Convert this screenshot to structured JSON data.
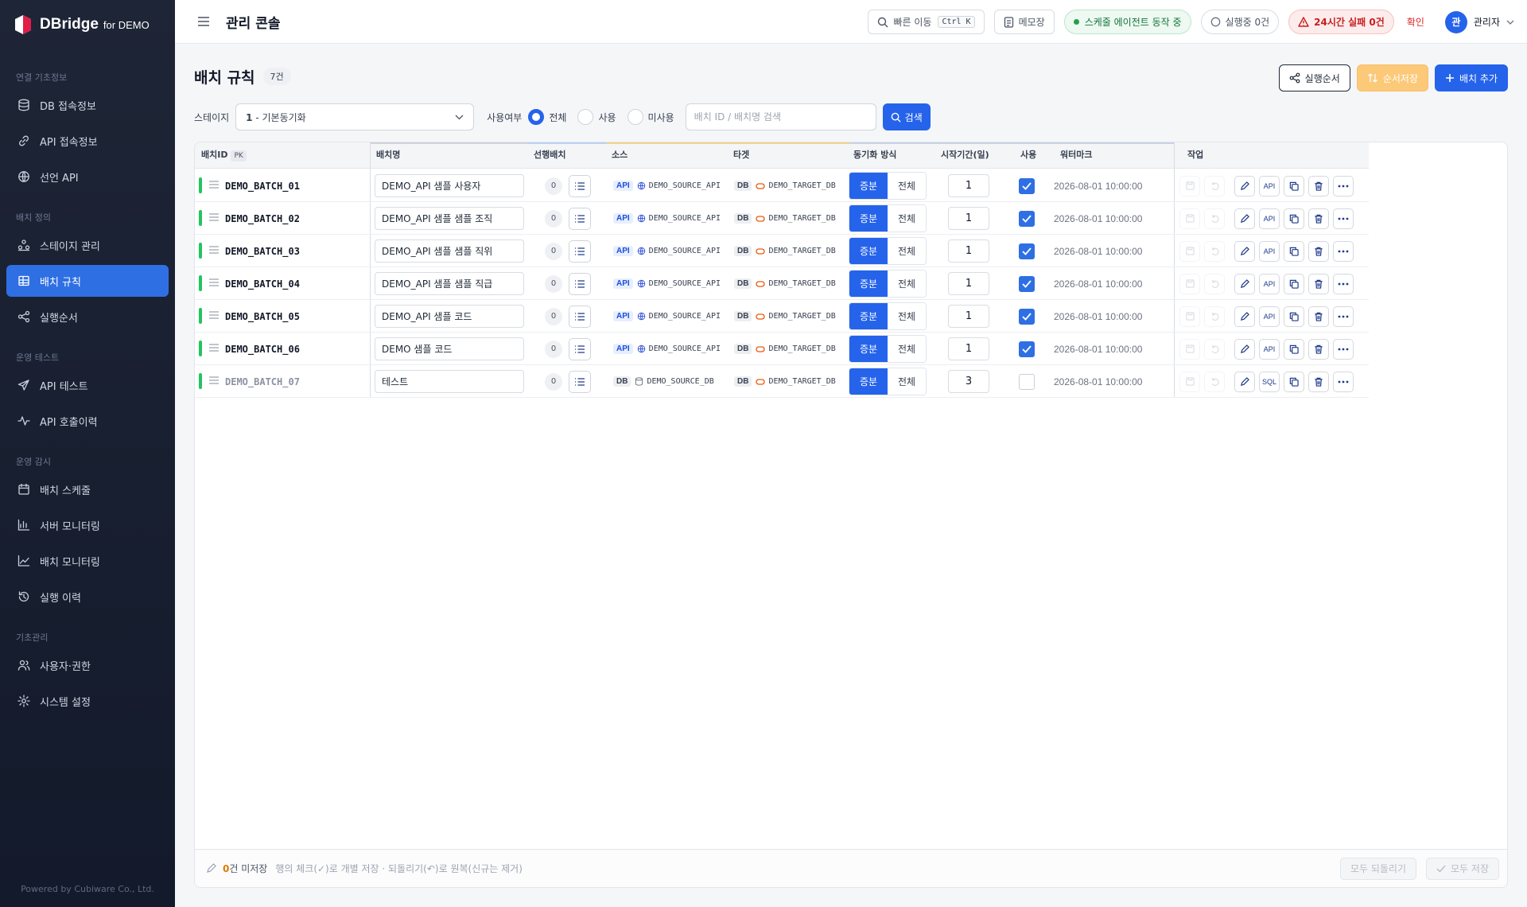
{
  "brand": {
    "name": "DBridge",
    "sub": "for DEMO",
    "footer": "Powered by Cubiware Co., Ltd."
  },
  "sidebar": {
    "sections": [
      {
        "title": "연결 기초정보",
        "items": [
          {
            "label": "DB 접속정보",
            "icon": "database-icon"
          },
          {
            "label": "API 접속정보",
            "icon": "link-icon"
          },
          {
            "label": "선언 API",
            "icon": "globe-icon"
          }
        ]
      },
      {
        "title": "배치 정의",
        "items": [
          {
            "label": "스테이지 관리",
            "icon": "stage-icon"
          },
          {
            "label": "배치 규칙",
            "icon": "grid-icon",
            "active": true
          },
          {
            "label": "실행순서",
            "icon": "share-icon"
          }
        ]
      },
      {
        "title": "운영 테스트",
        "items": [
          {
            "label": "API 테스트",
            "icon": "send-icon"
          },
          {
            "label": "API 호출이력",
            "icon": "activity-icon"
          }
        ]
      },
      {
        "title": "운영 감시",
        "items": [
          {
            "label": "배치 스케줄",
            "icon": "calendar-icon"
          },
          {
            "label": "서버 모니터링",
            "icon": "bar-chart-icon"
          },
          {
            "label": "배치 모니터링",
            "icon": "line-chart-icon"
          },
          {
            "label": "실행 이력",
            "icon": "history-icon"
          }
        ]
      },
      {
        "title": "기초관리",
        "items": [
          {
            "label": "사용자·권한",
            "icon": "users-icon"
          },
          {
            "label": "시스템 설정",
            "icon": "gear-icon"
          }
        ]
      }
    ]
  },
  "topbar": {
    "title": "관리 콘솔",
    "quick": "빠른 이동",
    "shortcut": "Ctrl K",
    "memo": "메모장",
    "agent": "스케줄 에이전트 동작 중",
    "running": "실행중 0건",
    "failure": "24시간 실패 0건",
    "confirm": "확인",
    "avatar": "관",
    "user": "관리자"
  },
  "page": {
    "title": "배치 규칙",
    "count": "7건",
    "btn_order": "실행순서",
    "btn_save_order": "순서저장",
    "btn_add": "배치 추가"
  },
  "filter": {
    "stage_label": "스테이지",
    "stage_value_num": "1",
    "stage_value_name": " - 기본동기화",
    "use_label": "사용여부",
    "options": [
      "전체",
      "사용",
      "미사용"
    ],
    "selected": 0,
    "placeholder": "배치 ID / 배치명 검색",
    "search": "검색"
  },
  "table": {
    "headers": {
      "id": "배치ID",
      "pk": "PK",
      "name": "배치명",
      "pre": "선행배치",
      "source": "소스",
      "target": "타겟",
      "mode": "동기화 방식",
      "start": "시작기간(일)",
      "use": "사용",
      "watermark": "워터마크",
      "actions": "작업"
    },
    "rows": [
      {
        "id": "DEMO_BATCH_01",
        "name": "DEMO_API 샘플 사용자",
        "pre": "0",
        "src_type": "API",
        "src": "DEMO_SOURCE_API",
        "tgt_type": "DB",
        "tgt": "DEMO_TARGET_DB",
        "mode_a": "증분",
        "mode_b": "전체",
        "start": "1",
        "use": true,
        "wm": "2026-08-01 10:00:00",
        "kind": "API"
      },
      {
        "id": "DEMO_BATCH_02",
        "name": "DEMO_API 샘플 샘플 조직",
        "pre": "0",
        "src_type": "API",
        "src": "DEMO_SOURCE_API",
        "tgt_type": "DB",
        "tgt": "DEMO_TARGET_DB",
        "mode_a": "증분",
        "mode_b": "전체",
        "start": "1",
        "use": true,
        "wm": "2026-08-01 10:00:00",
        "kind": "API"
      },
      {
        "id": "DEMO_BATCH_03",
        "name": "DEMO_API 샘플 샘플 직위",
        "pre": "0",
        "src_type": "API",
        "src": "DEMO_SOURCE_API",
        "tgt_type": "DB",
        "tgt": "DEMO_TARGET_DB",
        "mode_a": "증분",
        "mode_b": "전체",
        "start": "1",
        "use": true,
        "wm": "2026-08-01 10:00:00",
        "kind": "API"
      },
      {
        "id": "DEMO_BATCH_04",
        "name": "DEMO_API 샘플 샘플 직급",
        "pre": "0",
        "src_type": "API",
        "src": "DEMO_SOURCE_API",
        "tgt_type": "DB",
        "tgt": "DEMO_TARGET_DB",
        "mode_a": "증분",
        "mode_b": "전체",
        "start": "1",
        "use": true,
        "wm": "2026-08-01 10:00:00",
        "kind": "API"
      },
      {
        "id": "DEMO_BATCH_05",
        "name": "DEMO_API 샘플 코드",
        "pre": "0",
        "src_type": "API",
        "src": "DEMO_SOURCE_API",
        "tgt_type": "DB",
        "tgt": "DEMO_TARGET_DB",
        "mode_a": "증분",
        "mode_b": "전체",
        "start": "1",
        "use": true,
        "wm": "2026-08-01 10:00:00",
        "kind": "API"
      },
      {
        "id": "DEMO_BATCH_06",
        "name": "DEMO 샘플 코드",
        "pre": "0",
        "src_type": "API",
        "src": "DEMO_SOURCE_API",
        "tgt_type": "DB",
        "tgt": "DEMO_TARGET_DB",
        "mode_a": "증분",
        "mode_b": "전체",
        "start": "1",
        "use": true,
        "wm": "2026-08-01 10:00:00",
        "kind": "API"
      },
      {
        "id": "DEMO_BATCH_07",
        "name": "테스트",
        "pre": "0",
        "src_type": "DB",
        "src": "DEMO_SOURCE_DB",
        "tgt_type": "DB",
        "tgt": "DEMO_TARGET_DB",
        "mode_a": "증분",
        "mode_b": "전체",
        "start": "3",
        "use": false,
        "wm": "2026-08-01 10:00:00",
        "kind": "SQL"
      }
    ]
  },
  "footer": {
    "unsaved_count": "0",
    "unsaved_label": "건 미저장",
    "hint": "행의 체크(✓)로 개별 저장 · 되돌리기(↶)로 원복(신규는 제거)",
    "revert_all": "모두 되돌리기",
    "save_all": "모두 저장"
  },
  "colors": {
    "accent": "#2563eb",
    "sidebar_bg": "#1e2536",
    "active_stripe": "#22c55e",
    "failure": "#c81e1e",
    "agent_ok": "#14753d"
  }
}
